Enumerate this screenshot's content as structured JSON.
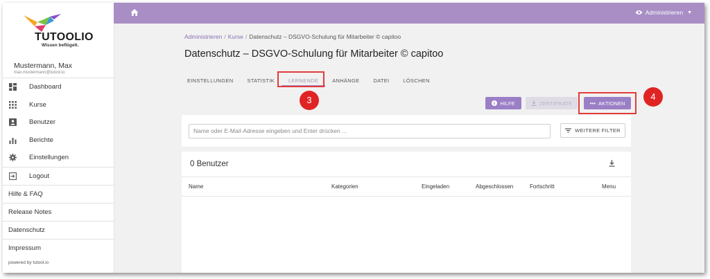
{
  "brand": {
    "name": "TUTOOLIO",
    "tagline": "Wissen beflügelt."
  },
  "user": {
    "name": "Mustermann, Max",
    "email": "max.mustermann@tutool.io"
  },
  "sidebar": {
    "items": [
      {
        "label": "Dashboard",
        "icon": "dashboard-icon"
      },
      {
        "label": "Kurse",
        "icon": "grid-icon"
      },
      {
        "label": "Benutzer",
        "icon": "person-icon"
      },
      {
        "label": "Berichte",
        "icon": "bar-chart-icon"
      },
      {
        "label": "Einstellungen",
        "icon": "gear-icon"
      },
      {
        "label": "Logout",
        "icon": "logout-icon"
      }
    ],
    "links": [
      "Hilfe & FAQ",
      "Release Notes",
      "Datenschutz",
      "Impressum"
    ],
    "powered": "powered by tutool.io"
  },
  "topbar": {
    "admin_label": "Administrieren",
    "color": "#a88ec5"
  },
  "breadcrumb": {
    "items": [
      "Administrieren",
      "Kurse",
      "Datenschutz – DSGVO-Schulung für Mitarbeiter © capitoo"
    ]
  },
  "page_title": "Datenschutz – DSGVO-Schulung für Mitarbeiter © capitoo",
  "tabs": [
    "EINSTELLUNGEN",
    "STATISTIK",
    "LERNENDE",
    "ANHÄNGE",
    "DATEI",
    "LÖSCHEN"
  ],
  "active_tab": "LERNENDE",
  "actions": {
    "hilfe": "HILFE",
    "zertifikate": "ZERTIFIKATE",
    "aktionen": "AKTIONEN"
  },
  "annotations": {
    "step3": "3",
    "step4": "4"
  },
  "search": {
    "placeholder": "Name oder E-Mail-Adresse eingeben und Enter drücken ...",
    "filter_label": "WEITERE FILTER"
  },
  "table": {
    "count_label": "0 Benutzer",
    "columns": [
      "Name",
      "Kategorien",
      "Eingeladen",
      "Abgeschlossen",
      "Fortschritt",
      "Menu"
    ],
    "rows": []
  }
}
